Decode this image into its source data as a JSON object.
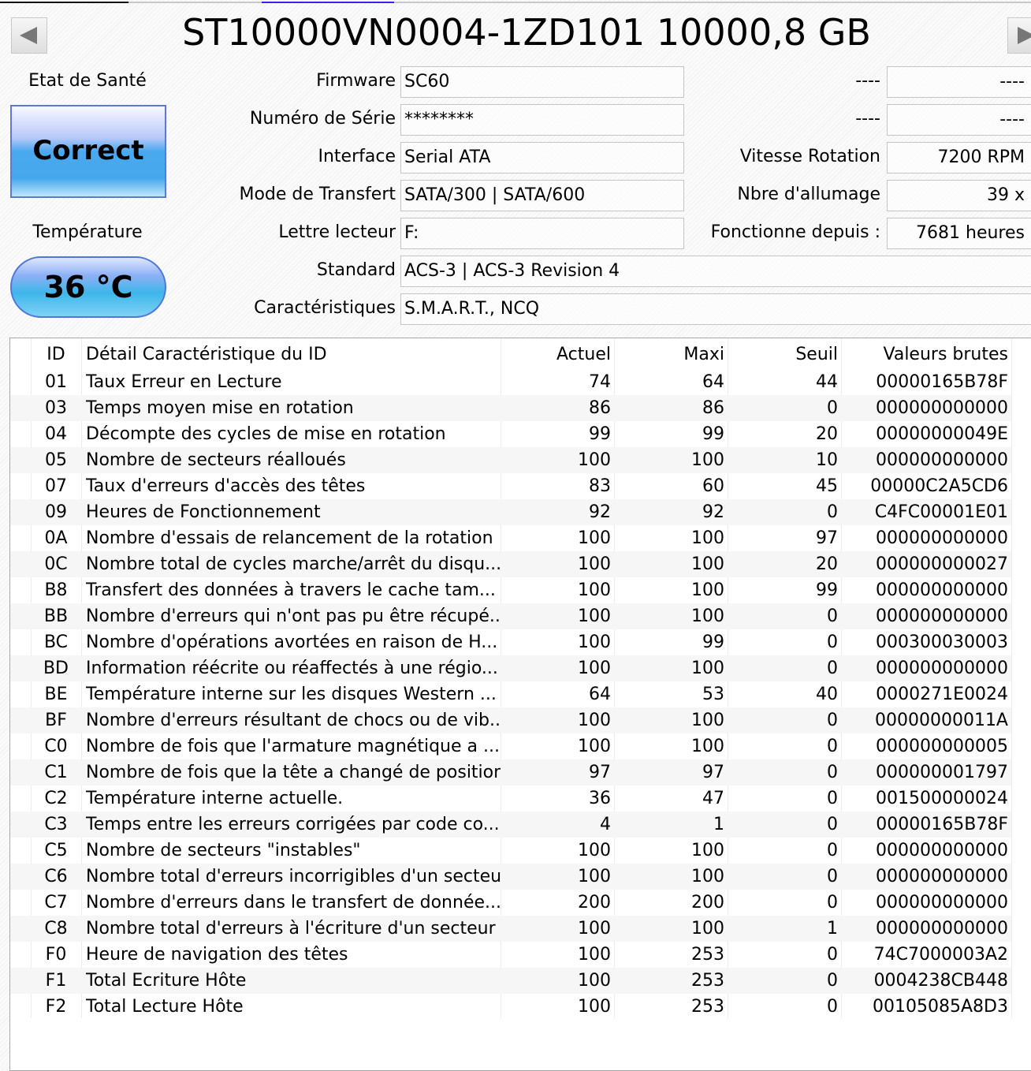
{
  "title": "ST10000VN0004-1ZD101 10000,8 GB",
  "health": {
    "label": "Etat de Santé",
    "status": "Correct"
  },
  "temperature": {
    "label": "Température",
    "value": "36 °C"
  },
  "info_left": [
    {
      "label": "Firmware",
      "value": "SC60"
    },
    {
      "label": "Numéro de Série",
      "value": "********"
    },
    {
      "label": "Interface",
      "value": "Serial ATA"
    },
    {
      "label": "Mode de Transfert",
      "value": "SATA/300 | SATA/600"
    },
    {
      "label": "Lettre lecteur",
      "value": "F:"
    }
  ],
  "info_right": [
    {
      "label": "----",
      "value": "----"
    },
    {
      "label": "----",
      "value": "----"
    },
    {
      "label": "Vitesse Rotation",
      "value": "7200 RPM"
    },
    {
      "label": "Nbre d'allumage",
      "value": "39 x"
    },
    {
      "label": "Fonctionne depuis :",
      "value": "7681 heures"
    }
  ],
  "info_wide": [
    {
      "label": "Standard",
      "value": "ACS-3 | ACS-3 Revision 4"
    },
    {
      "label": "Caractéristiques",
      "value": "S.M.A.R.T., NCQ"
    }
  ],
  "table": {
    "headers": [
      "ID",
      "Détail Caractéristique du ID",
      "Actuel",
      "Maxi",
      "Seuil",
      "Valeurs brutes"
    ],
    "rows": [
      [
        "01",
        "Taux Erreur en Lecture",
        "74",
        "64",
        "44",
        "00000165B78F"
      ],
      [
        "03",
        "Temps moyen mise en rotation",
        "86",
        "86",
        "0",
        "000000000000"
      ],
      [
        "04",
        "Décompte des cycles de mise en rotation",
        "99",
        "99",
        "20",
        "00000000049E"
      ],
      [
        "05",
        "Nombre de secteurs réalloués",
        "100",
        "100",
        "10",
        "000000000000"
      ],
      [
        "07",
        "Taux d'erreurs d'accès des têtes",
        "83",
        "60",
        "45",
        "00000C2A5CD6"
      ],
      [
        "09",
        "Heures de Fonctionnement",
        "92",
        "92",
        "0",
        "C4FC00001E01"
      ],
      [
        "0A",
        "Nombre d'essais de relancement de la rotation",
        "100",
        "100",
        "97",
        "000000000000"
      ],
      [
        "0C",
        "Nombre total de cycles marche/arrêt du disqu...",
        "100",
        "100",
        "20",
        "000000000027"
      ],
      [
        "B8",
        "Transfert des données à travers le cache tam...",
        "100",
        "100",
        "99",
        "000000000000"
      ],
      [
        "BB",
        "Nombre d'erreurs qui n'ont pas pu être récupé...",
        "100",
        "100",
        "0",
        "000000000000"
      ],
      [
        "BC",
        "Nombre d'opérations avortées en raison de H...",
        "100",
        "99",
        "0",
        "000300030003"
      ],
      [
        "BD",
        "Information réécrite ou réaffectés à une régio...",
        "100",
        "100",
        "0",
        "000000000000"
      ],
      [
        "BE",
        "Température interne sur les disques Western ...",
        "64",
        "53",
        "40",
        "0000271E0024"
      ],
      [
        "BF",
        "Nombre d'erreurs résultant de chocs ou de vib...",
        "100",
        "100",
        "0",
        "00000000011A"
      ],
      [
        "C0",
        "Nombre de fois que l'armature magnétique a ...",
        "100",
        "100",
        "0",
        "000000000005"
      ],
      [
        "C1",
        "Nombre de fois que la tête a changé de position",
        "97",
        "97",
        "0",
        "000000001797"
      ],
      [
        "C2",
        "Température interne actuelle.",
        "36",
        "47",
        "0",
        "001500000024"
      ],
      [
        "C3",
        "Temps entre les erreurs corrigées par code co...",
        "4",
        "1",
        "0",
        "00000165B78F"
      ],
      [
        "C5",
        "Nombre de secteurs \"instables\"",
        "100",
        "100",
        "0",
        "000000000000"
      ],
      [
        "C6",
        "Nombre total d'erreurs incorrigibles d'un secteur",
        "100",
        "100",
        "0",
        "000000000000"
      ],
      [
        "C7",
        "Nombre d'erreurs dans le transfert de donnée...",
        "200",
        "200",
        "0",
        "000000000000"
      ],
      [
        "C8",
        "Nombre total d'erreurs à l'écriture d'un secteur",
        "100",
        "100",
        "1",
        "000000000000"
      ],
      [
        "F0",
        "Heure de navigation des têtes",
        "100",
        "253",
        "0",
        "74C7000003A2"
      ],
      [
        "F1",
        "Total Ecriture Hôte",
        "100",
        "253",
        "0",
        "0004238CB448"
      ],
      [
        "F2",
        "Total Lecture Hôte",
        "100",
        "253",
        "0",
        "00105085A8D3"
      ]
    ]
  }
}
